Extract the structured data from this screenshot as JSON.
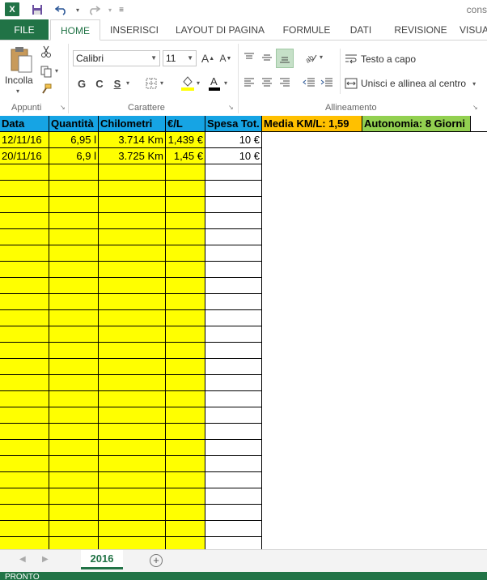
{
  "app": {
    "logo": "X",
    "doc_title": "cons"
  },
  "qat": {
    "save_icon": "save-icon",
    "undo_icon": "undo-icon",
    "redo_icon": "redo-icon",
    "customize_icon": "customize-icon"
  },
  "tabs": [
    {
      "label": "FILE"
    },
    {
      "label": "HOME"
    },
    {
      "label": "INSERISCI"
    },
    {
      "label": "LAYOUT DI PAGINA"
    },
    {
      "label": "FORMULE"
    },
    {
      "label": "DATI"
    },
    {
      "label": "REVISIONE"
    },
    {
      "label": "VISUA"
    }
  ],
  "ribbon": {
    "clipboard": {
      "label": "Appunti",
      "paste": "Incolla"
    },
    "font": {
      "label": "Carattere",
      "name": "Calibri",
      "size": "11",
      "bold": "G",
      "italic": "C",
      "underline": "S"
    },
    "alignment": {
      "label": "Allineamento",
      "wrap": "Testo a capo",
      "merge": "Unisci e allinea al centro"
    }
  },
  "sheet": {
    "headers": [
      "Data",
      "Quantità",
      "Chilometri",
      "€/L",
      "Spesa Tot."
    ],
    "rows": [
      [
        "12/11/16",
        "6,95 l",
        "3.714 Km",
        "1,439 €",
        "10 €"
      ],
      [
        "20/11/16",
        "6,9 l",
        "3.725 Km",
        "1,45 €",
        "10 €"
      ]
    ],
    "media": "Media KM/L: 1,59",
    "autonomia": "Autonomia: 8 Giorni",
    "colors": {
      "header": "#16a4e4",
      "fill": "#ffff00",
      "media": "#ffc000",
      "autonomia": "#92d050"
    }
  },
  "sheet_tabs": {
    "active": "2016"
  },
  "status": {
    "text": "PRONTO"
  }
}
